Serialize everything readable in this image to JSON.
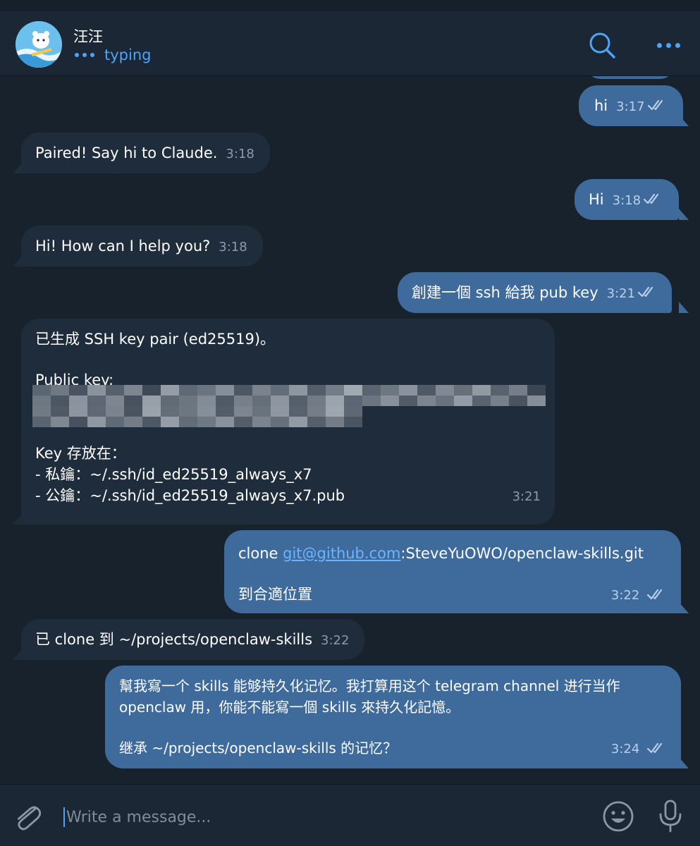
{
  "header": {
    "name": "汪汪",
    "status": "typing",
    "icons": {
      "search": "search-icon",
      "more": "more-icon"
    }
  },
  "messages": [
    {
      "id": "m1",
      "dir": "out",
      "text": "hi",
      "time": "3:17",
      "read": true
    },
    {
      "id": "m2",
      "dir": "in",
      "text": "Paired! Say hi to Claude.",
      "time": "3:18"
    },
    {
      "id": "m3",
      "dir": "out",
      "text": "Hi",
      "time": "3:18",
      "read": true
    },
    {
      "id": "m4",
      "dir": "in",
      "text": "Hi! How can I help you?",
      "time": "3:18"
    },
    {
      "id": "m5",
      "dir": "out",
      "text": "創建一個 ssh 給我 pub key",
      "time": "3:21",
      "read": true
    },
    {
      "id": "m6",
      "dir": "in",
      "line1": "已生成 SSH key pair (ed25519)。",
      "public_key_label": "Public key:",
      "key_location_label": "Key 存放在：",
      "private_key_line": "- 私鑰：~/.ssh/id_ed25519_always_x7",
      "public_key_line": "- 公鑰：~/.ssh/id_ed25519_always_x7.pub",
      "time": "3:21"
    },
    {
      "id": "m7",
      "dir": "out",
      "prefix": "clone ",
      "link": "git@github.com",
      "suffix": ":SteveYuOWO/openclaw-skills.git",
      "line2": "到合適位置",
      "time": "3:22",
      "read": true
    },
    {
      "id": "m8",
      "dir": "in",
      "text": "已 clone 到 ~/projects/openclaw-skills",
      "time": "3:22"
    },
    {
      "id": "m9",
      "dir": "out",
      "line1": "幫我寫一个 skills 能够持久化记忆。我打算用这个 telegram channel 进行当作",
      "line2": "openclaw 用，你能不能寫一個 skills 來持久化記憶。",
      "line3": "继承 ~/projects/openclaw-skills 的记忆？",
      "time": "3:24",
      "read": true
    }
  ],
  "composer": {
    "placeholder": "Write a message...",
    "icons": {
      "attach": "paperclip-icon",
      "emoji": "emoji-icon",
      "mic": "microphone-icon"
    }
  },
  "colors": {
    "background": "#18222d",
    "incoming_bubble": "#1f2c3c",
    "outgoing_bubble": "#3e6a9c",
    "accent": "#4ea4f6",
    "link": "#6bb5ff"
  }
}
